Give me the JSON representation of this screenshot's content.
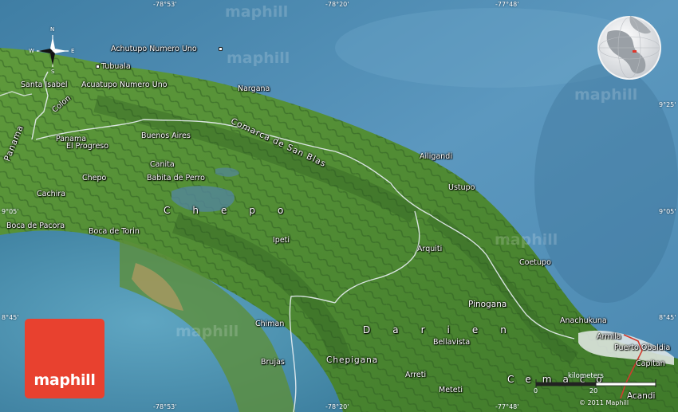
{
  "watermark": "maphill",
  "logo": {
    "text": "maphill"
  },
  "credit": "© 2011 Maphill",
  "compass": {
    "n": "N",
    "s": "S",
    "e": "E",
    "w": "W"
  },
  "scale": {
    "label": "kilometers",
    "zero": "0",
    "value": "20"
  },
  "coords": {
    "top": [
      "-78°53'",
      "-78°20'",
      "-77°48'"
    ],
    "bottom": [
      "-78°53'",
      "-78°20'",
      "-77°48'"
    ],
    "left": [
      "9°05'",
      "8°45'"
    ],
    "right": [
      "9°25'",
      "9°05'",
      "8°45'"
    ]
  },
  "places": [
    {
      "name": "Achutupo Numero Uno"
    },
    {
      "name": "Tubuala"
    },
    {
      "name": "Santa Isabel"
    },
    {
      "name": "Acuatupo Numero Uno"
    },
    {
      "name": "Nargana"
    },
    {
      "name": "Colon"
    },
    {
      "name": "Panama"
    },
    {
      "name": "El Progreso"
    },
    {
      "name": "Buenos Aires"
    },
    {
      "name": "Ailigandi"
    },
    {
      "name": "Canita"
    },
    {
      "name": "Chepo"
    },
    {
      "name": "Babita de Perro"
    },
    {
      "name": "Ustupo"
    },
    {
      "name": "Cachira"
    },
    {
      "name": "Boca de Pacora"
    },
    {
      "name": "Boca de Torin"
    },
    {
      "name": "Ipeti"
    },
    {
      "name": "Arquiti"
    },
    {
      "name": "Coetupo"
    },
    {
      "name": "Pinogana"
    },
    {
      "name": "Anachukuna"
    },
    {
      "name": "Chiman"
    },
    {
      "name": "Bellavista"
    },
    {
      "name": "Brujas"
    },
    {
      "name": "Chepigana"
    },
    {
      "name": "Arreti"
    },
    {
      "name": "Meteti"
    },
    {
      "name": "Armila"
    },
    {
      "name": "Puerto Obaldia"
    },
    {
      "name": "Capitan"
    },
    {
      "name": "Acandi"
    }
  ],
  "regions": [
    {
      "name": "Comarca de San Blas"
    },
    {
      "name": "Panama"
    },
    {
      "name": "Chepo"
    },
    {
      "name": "Darien"
    },
    {
      "name": "Cemaco"
    }
  ]
}
